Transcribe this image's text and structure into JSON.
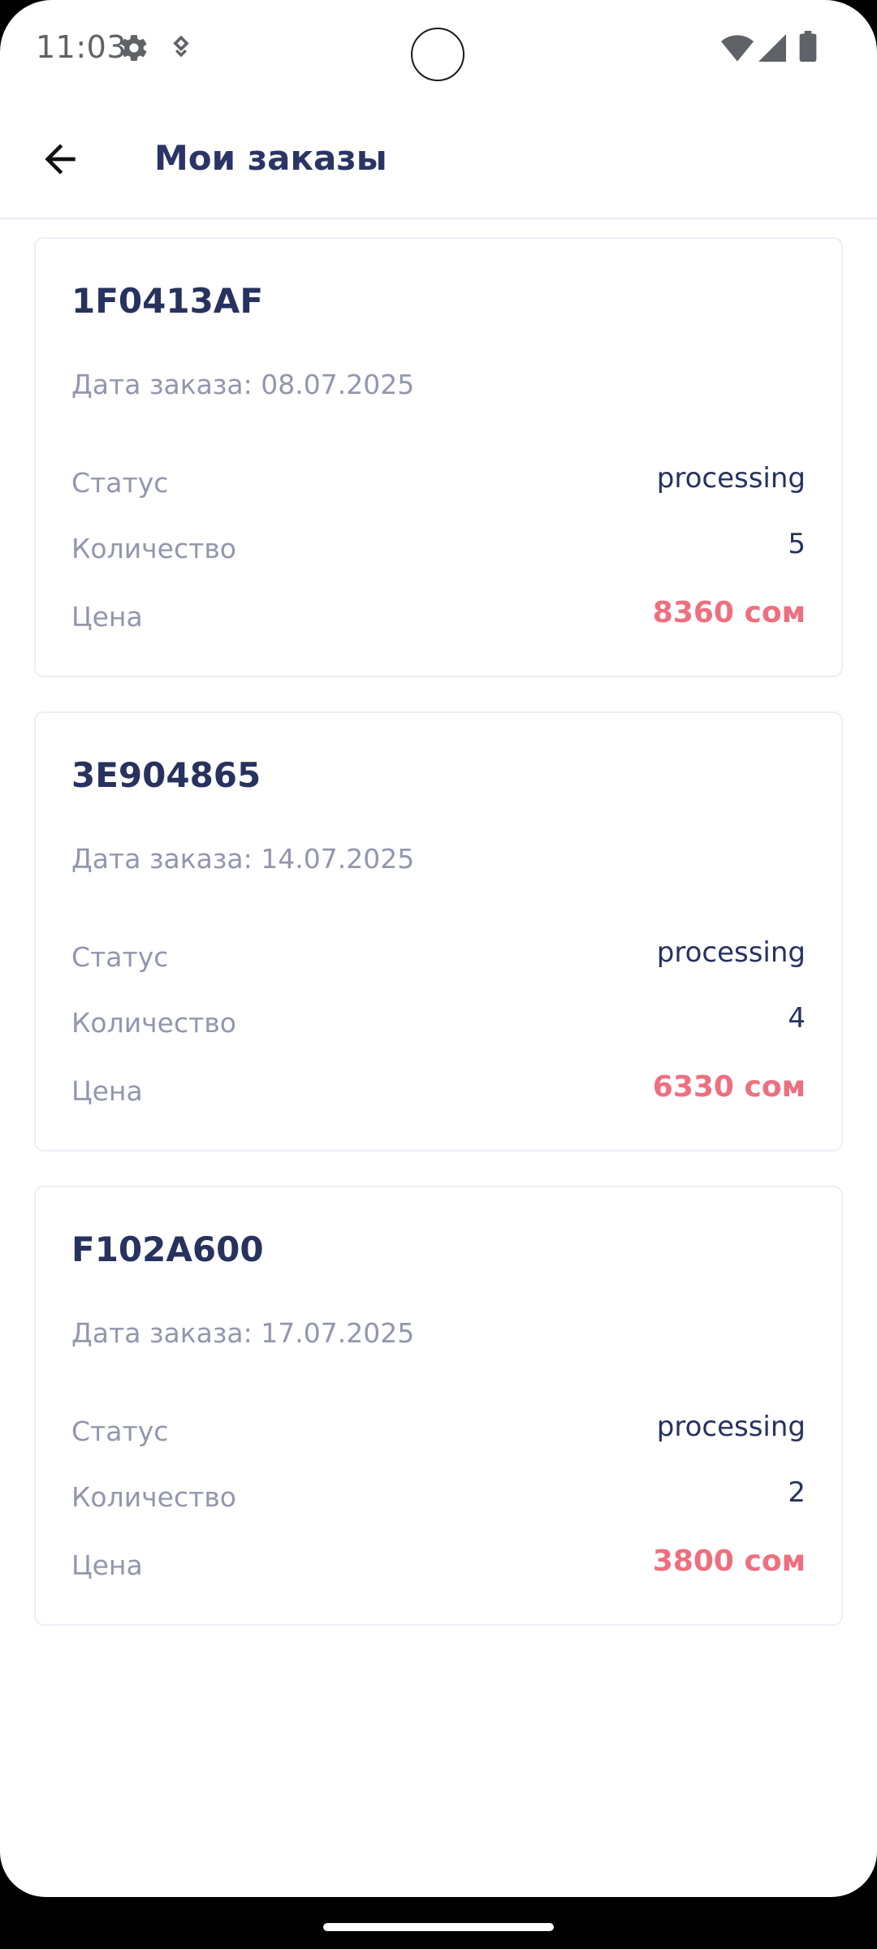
{
  "status_bar": {
    "time": "11:03",
    "icons": [
      "settings-icon",
      "location-icon",
      "wifi-icon",
      "signal-icon",
      "battery-icon"
    ]
  },
  "app_bar": {
    "back_icon": "arrow-left-icon",
    "title": "Мои заказы"
  },
  "labels": {
    "status": "Статус",
    "quantity": "Количество",
    "price": "Цена"
  },
  "orders": [
    {
      "id": "1F0413AF",
      "date": "Дата заказа: 08.07.2025",
      "status": "processing",
      "quantity": "5",
      "price": "8360 сом"
    },
    {
      "id": "3E904865",
      "date": "Дата заказа: 14.07.2025",
      "status": "processing",
      "quantity": "4",
      "price": "6330 сом"
    },
    {
      "id": "F102A600",
      "date": "Дата заказа: 17.07.2025",
      "status": "processing",
      "quantity": "2",
      "price": "3800 сом"
    }
  ],
  "colors": {
    "title": "#2a3566",
    "muted": "#9297ad",
    "price": "#ef6f7f",
    "border": "#eceef7"
  }
}
